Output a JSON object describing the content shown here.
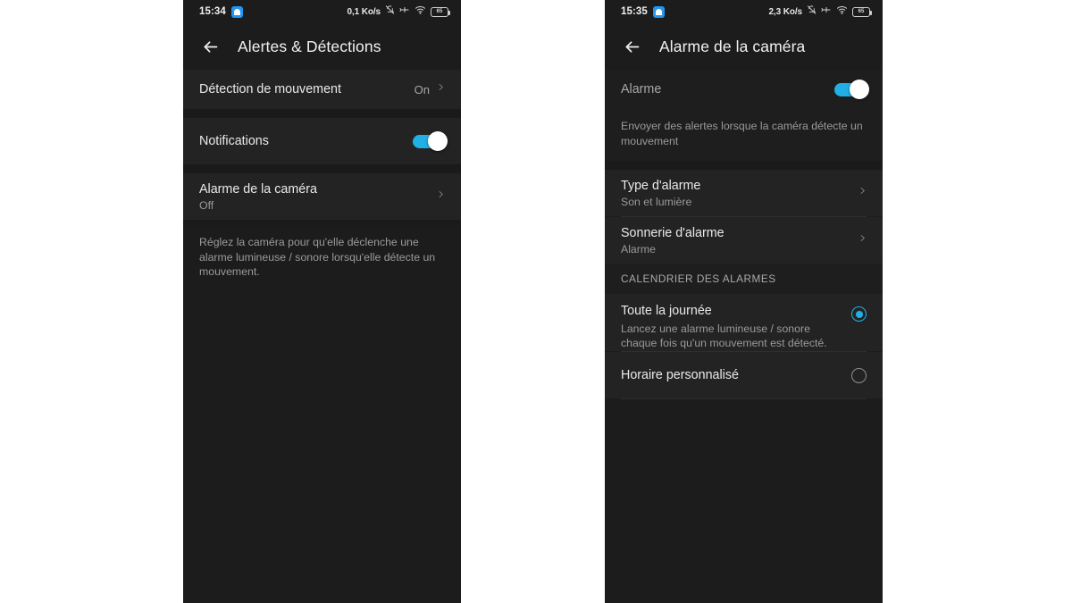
{
  "screen_left": {
    "status_bar": {
      "time": "15:34",
      "app_badge_icon": "home-app-badge-icon",
      "data_rate": "0,1 Ko/s",
      "icons": [
        "bell-off-icon",
        "vibrate-icon",
        "wifi-icon",
        "battery-icon"
      ],
      "battery_level": "65"
    },
    "appbar": {
      "back_icon": "back-arrow-icon",
      "title": "Alertes & Détections"
    },
    "rows": {
      "motion_detection": {
        "title": "Détection de mouvement",
        "value": "On",
        "chevron_icon": "chevron-right-icon"
      },
      "notifications": {
        "title": "Notifications",
        "toggle_state": "on"
      },
      "camera_alarm": {
        "title": "Alarme de la caméra",
        "subtitle": "Off",
        "chevron_icon": "chevron-right-icon"
      }
    },
    "blurb": "Réglez la caméra pour qu'elle déclenche une alarme lumineuse / sonore lorsqu'elle détecte un mouvement."
  },
  "screen_right": {
    "status_bar": {
      "time": "15:35",
      "app_badge_icon": "home-app-badge-icon",
      "data_rate": "2,3 Ko/s",
      "icons": [
        "bell-off-icon",
        "vibrate-icon",
        "wifi-icon",
        "battery-icon"
      ],
      "battery_level": "65"
    },
    "appbar": {
      "back_icon": "back-arrow-icon",
      "title": "Alarme de la caméra"
    },
    "rows": {
      "alarm": {
        "title": "Alarme",
        "toggle_state": "on"
      },
      "alarm_blurb": "Envoyer des alertes lorsque la caméra détecte un mouvement",
      "alarm_type": {
        "title": "Type d'alarme",
        "subtitle": "Son et lumière",
        "chevron_icon": "chevron-right-icon"
      },
      "alarm_ringtone": {
        "title": "Sonnerie d'alarme",
        "subtitle": "Alarme",
        "chevron_icon": "chevron-right-icon"
      },
      "schedule_section_header": "CALENDRIER DES ALARMES",
      "all_day": {
        "title": "Toute la journée",
        "subtitle": "Lancez une alarme lumineuse / sonore chaque fois qu'un mouvement est détecté.",
        "selected": true
      },
      "custom_schedule": {
        "title": "Horaire personnalisé",
        "selected": false
      }
    }
  },
  "colors": {
    "accent": "#21b0e6",
    "panel_bg": "#1c1c1c",
    "row_bg": "#232323",
    "page_bg": "#ffffff"
  }
}
